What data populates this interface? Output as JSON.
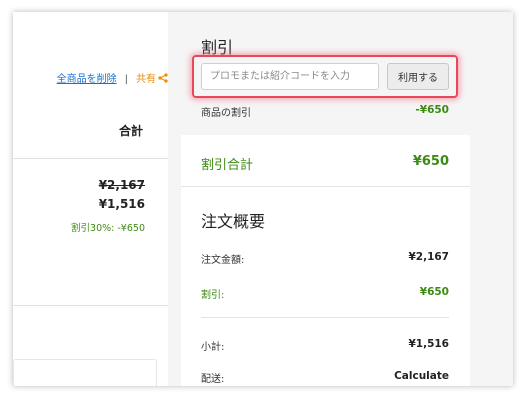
{
  "cart": {
    "delete_all": "全商品を削除",
    "separator": "|",
    "share": "共有",
    "total_header": "合計",
    "item": {
      "original_price": "¥2,167",
      "price": "¥1,516",
      "discount_note": "割引30%:  -¥650"
    }
  },
  "discount": {
    "title": "割引",
    "code_placeholder": "プロモまたは紹介コードを入力",
    "code_value": "",
    "apply_label": "利用する",
    "product_discount_label": "商品の割引",
    "product_discount_value": "-¥650",
    "total_label": "割引合計",
    "total_value": "¥650"
  },
  "summary": {
    "title": "注文概要",
    "order_amount_label": "注文金額:",
    "order_amount_value": "¥2,167",
    "discount_label": "割引:",
    "discount_value": "¥650",
    "subtotal_label": "小計:",
    "subtotal_value": "¥1,516",
    "shipping_label": "配送:",
    "shipping_value": "Calculate"
  },
  "colors": {
    "link": "#1a6fc9",
    "share": "#ee8a00",
    "discount_green": "#3d8a12",
    "highlight": "#e8485a"
  },
  "icons": {
    "share": "share-icon"
  }
}
